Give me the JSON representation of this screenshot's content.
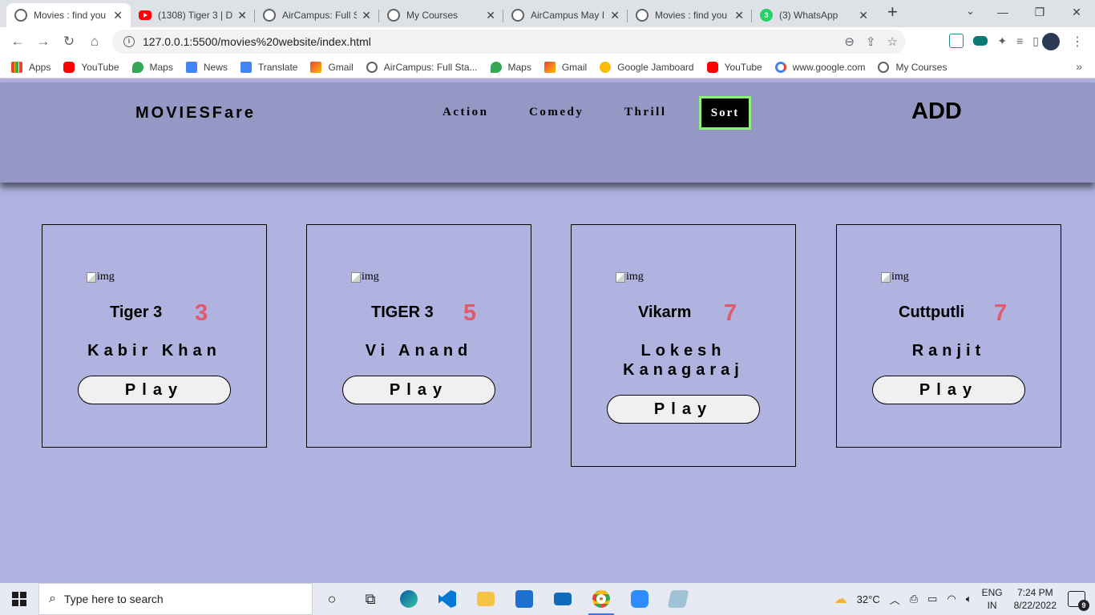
{
  "browser": {
    "tabs": [
      {
        "title": "Movies : find you",
        "favicon": "globe-icon",
        "active": true
      },
      {
        "title": "(1308) Tiger 3 | D",
        "favicon": "youtube-icon",
        "active": false
      },
      {
        "title": "AirCampus: Full S",
        "favicon": "globe-icon",
        "active": false
      },
      {
        "title": "My Courses",
        "favicon": "globe-icon",
        "active": false
      },
      {
        "title": "AirCampus May I",
        "favicon": "globe-icon",
        "active": false
      },
      {
        "title": "Movies : find you",
        "favicon": "globe-icon",
        "active": false
      },
      {
        "title": "(3) WhatsApp",
        "favicon": "whatsapp-icon",
        "badge": "3",
        "active": false
      }
    ],
    "url": "127.0.0.1:5500/movies%20website/index.html",
    "bookmarks": [
      {
        "label": "Apps",
        "icon": "apps-grid-icon",
        "color": "#4285f4"
      },
      {
        "label": "YouTube",
        "icon": "youtube-icon",
        "color": "#ff0000"
      },
      {
        "label": "Maps",
        "icon": "maps-pin-icon",
        "color": "#34a853"
      },
      {
        "label": "News",
        "icon": "news-icon",
        "color": "#4285f4"
      },
      {
        "label": "Translate",
        "icon": "translate-icon",
        "color": "#4285f4"
      },
      {
        "label": "Gmail",
        "icon": "gmail-icon",
        "color": "#ea4335"
      },
      {
        "label": "AirCampus: Full Sta...",
        "icon": "globe-icon",
        "color": "#5f6368"
      },
      {
        "label": "Maps",
        "icon": "maps-pin-icon",
        "color": "#34a853"
      },
      {
        "label": "Gmail",
        "icon": "gmail-icon",
        "color": "#ea4335"
      },
      {
        "label": "Google Jamboard",
        "icon": "jamboard-icon",
        "color": "#fbbc04"
      },
      {
        "label": "YouTube",
        "icon": "youtube-icon",
        "color": "#ff0000"
      },
      {
        "label": "www.google.com",
        "icon": "google-icon",
        "color": "#4285f4"
      },
      {
        "label": "My Courses",
        "icon": "globe-icon",
        "color": "#5f6368"
      }
    ]
  },
  "site": {
    "brand": "MOVIESFare",
    "nav": [
      "Action",
      "Comedy",
      "Thrill"
    ],
    "sort_label": "Sort",
    "add_label": "ADD",
    "colors": {
      "header_bg": "#9598c5",
      "page_bg": "#b0b3df",
      "rating": "#e05a6a",
      "sort_border": "#8fef7f"
    },
    "movies": [
      {
        "img_alt": "img",
        "title": "Tiger 3",
        "rating": "3",
        "director": "Kabir Khan",
        "play_label": "Play"
      },
      {
        "img_alt": "img",
        "title": "TIGER 3",
        "rating": "5",
        "director": "Vi Anand",
        "play_label": "Play"
      },
      {
        "img_alt": "img",
        "title": "Vikarm",
        "rating": "7",
        "director": "Lokesh Kanagaraj",
        "play_label": "Play"
      },
      {
        "img_alt": "img",
        "title": "Cuttputli",
        "rating": "7",
        "director": "Ranjit",
        "play_label": "Play"
      }
    ]
  },
  "taskbar": {
    "search_placeholder": "Type here to search",
    "weather": "32°C",
    "lang_line1": "ENG",
    "lang_line2": "IN",
    "time": "7:24 PM",
    "date": "8/22/2022",
    "notifications": "9"
  }
}
